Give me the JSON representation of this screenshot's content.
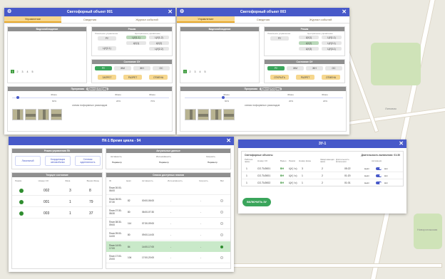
{
  "map": {
    "labels": [
      "Липовая",
      "Новорогожская"
    ]
  },
  "w1": {
    "title": "Светофорный объект 001",
    "tabs": [
      "Управление",
      "Сведения",
      "Журнал событий"
    ],
    "video_head": "Видеонаблюдение",
    "mode_head": "Режим",
    "mode_sub": [
      "Локальное управление",
      "Центральное управление"
    ],
    "mode_btns": [
      "РУ",
      "ЦУ(1-1)",
      "ЦУ(1-2)",
      "ЦУ(1)",
      "ЦУ(2)",
      "ЦУ(2-1)",
      "ЦУ(2-2)"
    ],
    "state_head": "Состояние ОУ",
    "state_btns": [
      "РУ",
      "ЖМ",
      "ЖН",
      "ОС"
    ],
    "state_btns2": [
      "ЗАПРЕТ",
      "РАЗРЕТ",
      "ОТМЕНА"
    ],
    "pages": [
      "1",
      "2",
      "3",
      "4",
      "5"
    ],
    "prog_head": "Программа",
    "prog_badge": "С(всех)1/СО(нач)",
    "ticks": [
      "40мин",
      "30мин",
      "30мин"
    ],
    "pcts": [
      "60%",
      "20%",
      "70%"
    ],
    "scheme": "схема поформных раскладов"
  },
  "w2": {
    "title": "Светофорный объект 003",
    "tabs": [
      "Управление",
      "Сведения",
      "Журнал событий"
    ],
    "video_head": "Видеонаблюдение",
    "mode_head": "Режим",
    "mode_sub": [
      "Локальное управление",
      "Центральное управление"
    ],
    "mode_btns": [
      "РУ",
      "ЦУ(1)",
      "ЦУ(1-1)",
      "ЦУ(2)",
      "ЦУ(2-1)",
      "ЦУ(3)",
      "ЦУ(3-1)"
    ],
    "state_head": "Состояние ОУ",
    "state_btns": [
      "РУ",
      "ЖМ",
      "ЖН",
      "ОС"
    ],
    "state_btns2": [
      "ОТКРЫТЬ",
      "РАЗРЕТ",
      "ОТМЕНА"
    ],
    "pages": [
      "1",
      "2",
      "3",
      "4",
      "5"
    ],
    "prog_head": "Программа",
    "prog_badge": "С(всех)2/СО(нач)",
    "ticks": [
      "40мин",
      "30мин",
      "30мин"
    ],
    "pcts": [
      "60%",
      "20%",
      "20%"
    ],
    "scheme": "схема поформных раскладов"
  },
  "w3": {
    "title": "ПК-1 Время цикла - 94",
    "mode_head": "Режим управления ПК",
    "mode_btns": [
      "Локальный",
      "Координация автомобилях",
      "Сетевая адаптивность"
    ],
    "act_head": "Актуальные данные",
    "act_cols": [
      "Активность",
      "Интенсивность",
      "Скорость"
    ],
    "act_vals": [
      "Параметр",
      "Параметр",
      "Параметр"
    ],
    "cur_head": "Текущее состояние",
    "cur_cols": [
      "Режим",
      "Номер СО",
      "Фаза",
      "Время Фазы"
    ],
    "cur_rows": [
      {
        "no": "002",
        "phase": "3",
        "time": "8"
      },
      {
        "no": "001",
        "phase": "1",
        "time": "79"
      },
      {
        "no": "003",
        "phase": "1",
        "time": "37"
      }
    ],
    "plan_head": "Список доступных планов",
    "plan_cols": [
      "ID",
      "Цикл",
      "Активность",
      "Интенсивность",
      "Скорость",
      "Вкл"
    ],
    "plans": [
      {
        "label": "План 00:00-06:00",
        "id": "",
        "cyc": "",
        "act": "",
        "int": "",
        "spd": ""
      },
      {
        "label": "План 06:00-07:30",
        "id": "",
        "cyc": "82",
        "act": "00:00-06:00",
        "int": "-",
        "spd": "-"
      },
      {
        "label": "План 07:30-08:30",
        "id": "",
        "cyc": "80",
        "act": "06:00-07:30",
        "int": "-",
        "spd": "-"
      },
      {
        "label": "План 08:30-09:00",
        "id": "",
        "cyc": "114",
        "act": "07:30-09:00",
        "int": "-",
        "spd": "-"
      },
      {
        "label": "План 09:00-14:00",
        "id": "",
        "cyc": "80",
        "act": "09:00-14:00",
        "int": "-",
        "spd": "-"
      },
      {
        "label": "План 14:00-17:00",
        "id": "",
        "cyc": "84",
        "act": "14:00-17:00",
        "int": "-",
        "spd": "-"
      },
      {
        "label": "План 17:00-20:00",
        "id": "",
        "cyc": "104",
        "act": "17:00-20:00",
        "int": "-",
        "spd": "-"
      }
    ]
  },
  "w4": {
    "title": "ЗУ-1",
    "left_head": "Светофорные объекты",
    "right_head": "Длительность включения: 01:30",
    "cols": [
      "Рабочие фазы",
      "Номер СО",
      "Видео",
      "Режим",
      "Номер фазы",
      "Завершающая фаза",
      "Длительность включения",
      "Активация"
    ],
    "rows": [
      {
        "ph": "1",
        "no": "СО-TU0001",
        "vid": "ВН",
        "mode": "ЦУ( I с)",
        "nf": "3",
        "end": "2",
        "dur": "05:22",
        "act": "выкл"
      },
      {
        "ph": "1",
        "no": "СО-TU0001",
        "vid": "ВН",
        "mode": "ЦУ( I с)",
        "nf": "1",
        "end": "2",
        "dur": "01:20",
        "act": "выкл"
      },
      {
        "ph": "1",
        "no": "СО-TU0002",
        "vid": "ВН",
        "mode": "ЦУ( I с)",
        "nf": "1",
        "end": "2",
        "dur": "01:01",
        "act": "выкл"
      }
    ],
    "on_label": "вкл",
    "button": "ВКЛЮЧИТЬ ЗУ"
  }
}
